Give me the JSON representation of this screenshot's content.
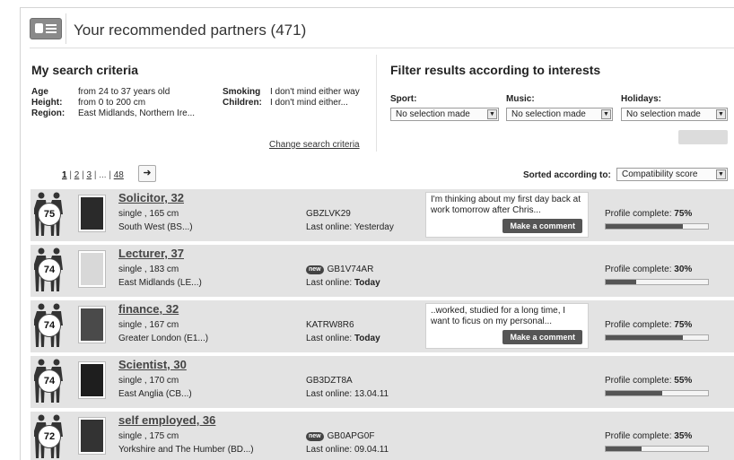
{
  "header": {
    "title": "Your recommended partners (471)",
    "icon": "profile-card-icon"
  },
  "criteria": {
    "title": "My search criteria",
    "age_label": "Age",
    "age_value": "from 24 to 37 years old",
    "height_label": "Height:",
    "height_value": "from 0 to 200 cm",
    "region_label": "Region:",
    "region_value": "East Midlands, Northern Ire...",
    "smoking_label": "Smoking",
    "smoking_value": "I don't mind either way",
    "children_label": "Children:",
    "children_value": "I don't mind either...",
    "change_link": "Change search criteria"
  },
  "filters": {
    "title": "Filter results according to interests",
    "sport_label": "Sport:",
    "sport_value": "No selection made",
    "music_label": "Music:",
    "music_value": "No selection made",
    "holidays_label": "Holidays:",
    "holidays_value": "No selection made"
  },
  "pager": {
    "p1": "1",
    "p2": "2",
    "p3": "3",
    "dots": "...",
    "last": "48",
    "sep": "|"
  },
  "sort": {
    "label": "Sorted according to:",
    "value": "Compatibility score"
  },
  "results": [
    {
      "score": "75",
      "name": "Solicitor, 32",
      "info1": "single , 165 cm",
      "info2": "South West (BS...)",
      "code": "GBZLVK29",
      "new": false,
      "online_prefix": "Last online: ",
      "online_value": "Yesterday",
      "online_bold": false,
      "comment": "I'm thinking about my first day back at work tomorrow after Chris...",
      "comment_btn": "Make a comment",
      "complete_label": "Profile complete: ",
      "complete_value": "75%",
      "complete_fraction": 0.75,
      "photo_color": "#2a2a2a"
    },
    {
      "score": "74",
      "name": "Lecturer, 37",
      "info1": "single , 183 cm",
      "info2": "East Midlands (LE...)",
      "code": "GB1V74AR",
      "new": true,
      "new_label": "new",
      "online_prefix": "Last online: ",
      "online_value": "Today",
      "online_bold": true,
      "comment": "",
      "comment_btn": "",
      "complete_label": "Profile complete: ",
      "complete_value": "30%",
      "complete_fraction": 0.3,
      "photo_color": "#d8d8d8"
    },
    {
      "score": "74",
      "name": "finance, 32",
      "info1": "single , 167 cm",
      "info2": "Greater London (E1...)",
      "code": "KATRW8R6",
      "new": false,
      "online_prefix": "Last online: ",
      "online_value": "Today",
      "online_bold": true,
      "comment": "..worked, studied for a long time, I want to ficus on my personal...",
      "comment_btn": "Make a comment",
      "complete_label": "Profile complete: ",
      "complete_value": "75%",
      "complete_fraction": 0.75,
      "photo_color": "#4a4a4a"
    },
    {
      "score": "74",
      "name": "Scientist, 30",
      "info1": "single , 170 cm",
      "info2": "East Anglia (CB...)",
      "code": "GB3DZT8A",
      "new": false,
      "online_prefix": "Last online: ",
      "online_value": "13.04.11",
      "online_bold": false,
      "comment": "",
      "comment_btn": "",
      "complete_label": "Profile complete: ",
      "complete_value": "55%",
      "complete_fraction": 0.55,
      "photo_color": "#1e1e1e"
    },
    {
      "score": "72",
      "name": "self employed, 36",
      "info1": "single , 175 cm",
      "info2": "Yorkshire and The Humber (BD...)",
      "code": "GB0APG0F",
      "new": true,
      "new_label": "new",
      "online_prefix": "Last online: ",
      "online_value": "09.04.11",
      "online_bold": false,
      "comment": "",
      "comment_btn": "",
      "complete_label": "Profile complete: ",
      "complete_value": "35%",
      "complete_fraction": 0.35,
      "photo_color": "#333333"
    }
  ]
}
